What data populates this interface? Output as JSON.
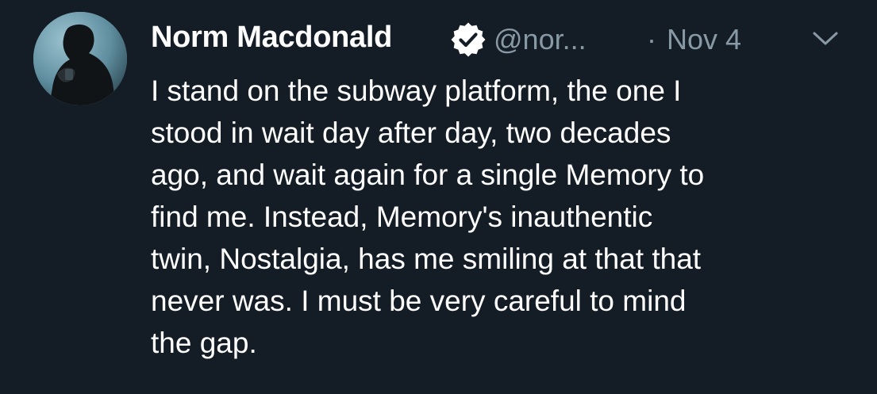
{
  "tweet": {
    "author": {
      "display_name": "Norm Macdonald",
      "handle": "@nor...",
      "verified": true,
      "avatar": "profile-photo-silhouette"
    },
    "separator": "·",
    "timestamp": "Nov 4",
    "menu_icon": "chevron-down-icon",
    "text_lines": [
      "I stand on the subway platform, the one I",
      "stood in wait day after day, two decades",
      "ago, and wait again for a single Memory to",
      "find me. Instead, Memory's inauthentic",
      "twin, Nostalgia, has me smiling at that that",
      "never was. I must be very careful to mind",
      "the gap."
    ]
  },
  "colors": {
    "background": "#141d26",
    "primary_text": "#ffffff",
    "secondary_text": "#8899a6",
    "verified_badge": "#ffffff"
  }
}
